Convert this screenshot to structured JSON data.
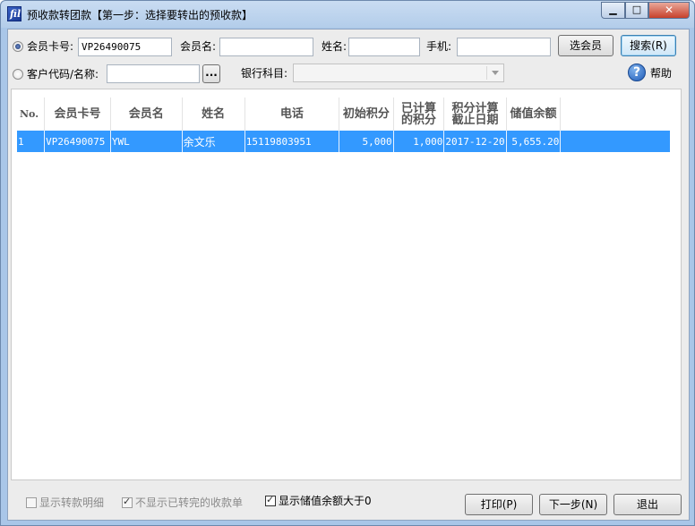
{
  "window": {
    "title": "预收款转团款【第一步：选择要转出的预收款】",
    "minimize": "▁",
    "maximize": "□",
    "close": "✕"
  },
  "search": {
    "radio_card_label": "会员卡号:",
    "card_value": "VP26490075",
    "member_name_label": "会员名:",
    "member_name_value": "",
    "name_label": "姓名:",
    "name_value": "",
    "phone_label": "手机:",
    "phone_value": "",
    "select_member_button": "选会员",
    "search_button": "搜索(R)",
    "radio_customer_label": "客户代码/名称:",
    "customer_value": "",
    "browse_button": "...",
    "bank_label": "银行科目:",
    "bank_value": "",
    "help_label": "帮助",
    "selected_mode": "card"
  },
  "table": {
    "columns": [
      "No.",
      "会员卡号",
      "会员名",
      "姓名",
      "电话",
      "初始积分",
      "已计算的积分",
      "积分计算截止日期",
      "储值余额"
    ],
    "rows": [
      {
        "no": "1",
        "card": "VP26490075",
        "member_name": "YWL",
        "name": "余文乐",
        "phone": "15119803951",
        "initial_points": "5,000",
        "calculated_points": "1,000",
        "points_cutoff_date": "2017-12-20",
        "stored_balance": "5,655.20"
      }
    ]
  },
  "footer": {
    "show_detail_label": "显示转款明细",
    "show_detail_checked": false,
    "hide_completed_label": "不显示已转完的收款单",
    "hide_completed_checked": true,
    "balance_gt_zero_label": "显示储值余额大于0",
    "balance_gt_zero_checked": true,
    "print_button": "打印(P)",
    "next_button": "下一步(N)",
    "exit_button": "退出"
  },
  "colors": {
    "selection": "#3399ff",
    "title_bar": "#b9d1ea",
    "close_button": "#c7412b"
  }
}
